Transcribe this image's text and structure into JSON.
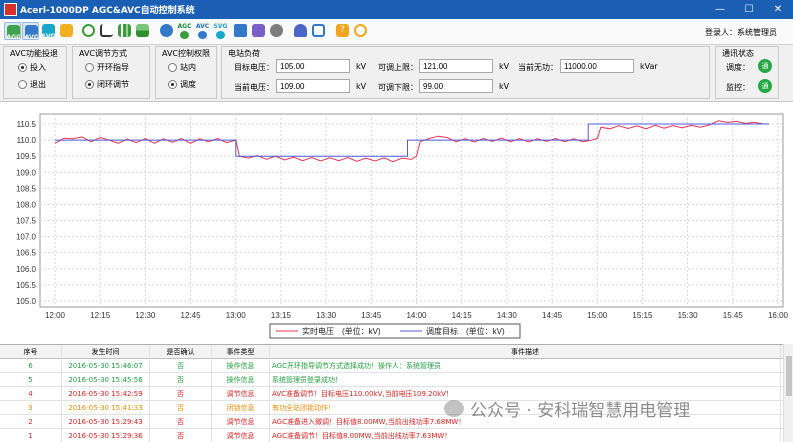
{
  "window": {
    "title": "Acerl-1000DP AGC&AVC自动控制系统",
    "min": "—",
    "max": "☐",
    "close": "✕"
  },
  "toolbar": {
    "agc": "AGC",
    "avc": "AVC",
    "svg": "SVG",
    "agc2": "AGC",
    "avc2": "AVC",
    "svg2": "SVG",
    "user_label": "登录人：",
    "user_name": "系统管理员"
  },
  "avc_switch": {
    "title": "AVC功能投退",
    "opt1": "投入",
    "opt2": "退出"
  },
  "avc_mode": {
    "title": "AVC调节方式",
    "opt1": "开环指导",
    "opt2": "闭环调节"
  },
  "avc_auth": {
    "title": "AVC控制权限",
    "opt1": "站内",
    "opt2": "调度"
  },
  "station_load": {
    "title": "电站负荷",
    "target_voltage_label": "目标电压：",
    "target_voltage": "105.00",
    "target_unit": "kV",
    "upper_label": "可调上限：",
    "upper": "121.00",
    "upper_unit": "kV",
    "reactive_label": "当前无功：",
    "reactive": "11000.00",
    "reactive_unit": "kVar",
    "current_voltage_label": "当前电压：",
    "current_voltage": "109.00",
    "current_unit": "kV",
    "lower_label": "可调下限：",
    "lower": "99.00",
    "lower_unit": "kV"
  },
  "comm": {
    "title": "通讯状态",
    "dispatch_label": "调度：",
    "dispatch_state": "通",
    "monitor_label": "监控：",
    "monitor_state": "通"
  },
  "chart_data": {
    "type": "line",
    "x": [
      "12:00",
      "12:15",
      "12:30",
      "12:45",
      "13:00",
      "13:15",
      "13:30",
      "13:45",
      "14:00",
      "14:15",
      "14:30",
      "14:45",
      "15:00",
      "15:15",
      "15:30",
      "15:45",
      "16:00"
    ],
    "ylim": [
      105.0,
      110.5
    ],
    "yticks": [
      "110.5",
      "110.0",
      "109.5",
      "109.0",
      "108.5",
      "108.0",
      "107.5",
      "107.0",
      "106.5",
      "106.0",
      "105.5",
      "105.0"
    ],
    "series": [
      {
        "name": "实时电压　(单位：kV)",
        "color": "#e8364a",
        "points": [
          [
            12.0,
            109.9
          ],
          [
            12.05,
            110.06
          ],
          [
            12.1,
            110.04
          ],
          [
            12.15,
            110.1
          ],
          [
            12.2,
            109.95
          ],
          [
            12.25,
            110.08
          ],
          [
            12.3,
            110.0
          ],
          [
            12.35,
            109.9
          ],
          [
            12.4,
            110.03
          ],
          [
            12.45,
            109.92
          ],
          [
            12.5,
            110.05
          ],
          [
            12.55,
            109.9
          ],
          [
            12.6,
            110.04
          ],
          [
            12.65,
            109.93
          ],
          [
            12.7,
            110.05
          ],
          [
            12.75,
            109.9
          ],
          [
            12.8,
            110.04
          ],
          [
            12.85,
            109.95
          ],
          [
            12.9,
            110.05
          ],
          [
            12.95,
            109.92
          ],
          [
            13.0,
            110.0
          ],
          [
            13.02,
            109.5
          ],
          [
            13.07,
            109.44
          ],
          [
            13.12,
            109.52
          ],
          [
            13.17,
            109.4
          ],
          [
            13.22,
            109.5
          ],
          [
            13.27,
            109.38
          ],
          [
            13.32,
            109.47
          ],
          [
            13.37,
            109.36
          ],
          [
            13.42,
            109.46
          ],
          [
            13.47,
            109.35
          ],
          [
            13.52,
            109.45
          ],
          [
            13.57,
            109.36
          ],
          [
            13.62,
            109.46
          ],
          [
            13.67,
            109.34
          ],
          [
            13.72,
            109.44
          ],
          [
            13.77,
            109.35
          ],
          [
            13.82,
            109.45
          ],
          [
            13.87,
            109.33
          ],
          [
            13.92,
            109.44
          ],
          [
            13.97,
            109.4
          ],
          [
            14.0,
            109.5
          ],
          [
            14.02,
            109.95
          ],
          [
            14.07,
            110.05
          ],
          [
            14.12,
            110.12
          ],
          [
            14.17,
            110.08
          ],
          [
            14.22,
            109.95
          ],
          [
            14.27,
            110.04
          ],
          [
            14.32,
            109.94
          ],
          [
            14.37,
            110.05
          ],
          [
            14.42,
            109.96
          ],
          [
            14.47,
            110.06
          ],
          [
            14.52,
            109.95
          ],
          [
            14.57,
            110.05
          ],
          [
            14.62,
            109.94
          ],
          [
            14.67,
            110.04
          ],
          [
            14.72,
            109.96
          ],
          [
            14.77,
            110.05
          ],
          [
            14.82,
            109.95
          ],
          [
            14.87,
            110.04
          ],
          [
            14.92,
            109.95
          ],
          [
            14.97,
            110.0
          ],
          [
            15.0,
            110.05
          ],
          [
            15.02,
            110.4
          ],
          [
            15.07,
            110.35
          ],
          [
            15.12,
            110.45
          ],
          [
            15.17,
            110.36
          ],
          [
            15.22,
            110.44
          ],
          [
            15.27,
            110.35
          ],
          [
            15.32,
            110.46
          ],
          [
            15.37,
            110.37
          ],
          [
            15.42,
            110.45
          ],
          [
            15.47,
            110.38
          ],
          [
            15.52,
            110.46
          ],
          [
            15.57,
            110.4
          ],
          [
            15.62,
            110.47
          ],
          [
            15.67,
            110.6
          ],
          [
            15.72,
            110.55
          ],
          [
            15.77,
            110.58
          ],
          [
            15.82,
            110.52
          ],
          [
            15.87,
            110.55
          ],
          [
            15.92,
            110.5
          ],
          [
            15.95,
            110.5
          ]
        ]
      },
      {
        "name": "调度目标　(单位：kV)",
        "color": "#4f5bd5",
        "points": [
          [
            12.0,
            110.0
          ],
          [
            13.0,
            110.0
          ],
          [
            13.0,
            109.5
          ],
          [
            13.95,
            109.5
          ],
          [
            13.95,
            110.0
          ],
          [
            14.95,
            110.0
          ],
          [
            14.95,
            110.5
          ],
          [
            15.95,
            110.5
          ]
        ]
      }
    ],
    "grid": true,
    "legend": "bottom-center"
  },
  "events": {
    "headers": [
      "序号",
      "发生时间",
      "是否确认",
      "事件类型",
      "事件描述"
    ],
    "rows": [
      {
        "id": "6",
        "time": "2016-05-30 15:46:07",
        "ack": "否",
        "type": "操作信息",
        "desc": "AGC开环指导调节方式选择成功！操作人：系统管理员",
        "color": "green"
      },
      {
        "id": "5",
        "time": "2016-05-30 15:45:56",
        "ack": "否",
        "type": "操作信息",
        "desc": "系统管理员登录成功！",
        "color": "green"
      },
      {
        "id": "4",
        "time": "2016-05-30 15:42:59",
        "ack": "否",
        "type": "调节信息",
        "desc": "AVC准备调节！目标电压110.00kV,当前电压109.20kV！",
        "color": "red"
      },
      {
        "id": "3",
        "time": "2016-05-30 15:41:33",
        "ack": "否",
        "type": "闭锁信息",
        "desc": "有功全站闭锁动作！",
        "color": "orange"
      },
      {
        "id": "2",
        "time": "2016-05-30 15:29:43",
        "ack": "否",
        "type": "调节信息",
        "desc": "AGC准备进入微调！目标值8.00MW,当前出线功率7.68MW！",
        "color": "red"
      },
      {
        "id": "1",
        "time": "2016-05-30 15:29:36",
        "ack": "否",
        "type": "调节信息",
        "desc": "AGC准备调节！目标值8.00MW,当前出线功率7.63MW！",
        "color": "red"
      }
    ]
  },
  "watermark": "公众号 · 安科瑞智慧用电管理"
}
